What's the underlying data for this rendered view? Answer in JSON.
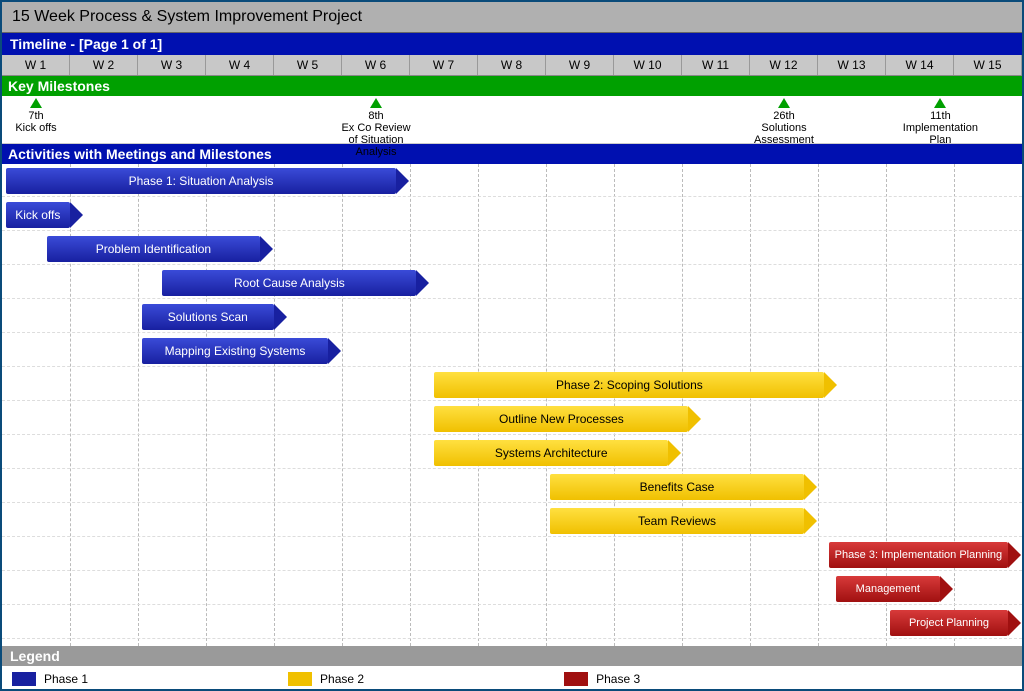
{
  "title": "15 Week Process & System Improvement Project",
  "timeline_label": "Timeline - [Page 1 of 1]",
  "weeks": [
    "W 1",
    "W 2",
    "W 3",
    "W 4",
    "W 5",
    "W 6",
    "W 7",
    "W 8",
    "W 9",
    "W 10",
    "W 11",
    "W 12",
    "W 13",
    "W 14",
    "W 15"
  ],
  "milestones_header": "Key Milestones",
  "activities_header": "Activities with Meetings and Milestones",
  "legend_header": "Legend",
  "milestones": [
    {
      "date": "7th",
      "label": "Kick offs",
      "week": 1
    },
    {
      "date": "8th",
      "label": "Ex Co Review of Situation Analysis",
      "week": 6
    },
    {
      "date": "26th",
      "label": "Solutions Assessment",
      "week": 12
    },
    {
      "date": "11th",
      "label": "Implementation Plan",
      "week": 14.3
    }
  ],
  "legend": [
    {
      "label": "Phase 1",
      "class": "p1"
    },
    {
      "label": "Phase 2",
      "class": "p2"
    },
    {
      "label": "Phase 3",
      "class": "p3"
    }
  ],
  "chart_data": {
    "type": "gantt",
    "title": "15 Week Process & System Improvement Project",
    "xlabel": "Week",
    "x_range": [
      0,
      15
    ],
    "series": [
      {
        "name": "Phase 1: Situation Analysis",
        "phase": "phase1",
        "start": 0,
        "end": 6,
        "row": 0
      },
      {
        "name": "Kick offs",
        "phase": "phase1",
        "start": 0,
        "end": 1.2,
        "row": 1
      },
      {
        "name": "Problem Identification",
        "phase": "phase1",
        "start": 0.6,
        "end": 4,
        "row": 2
      },
      {
        "name": "Root Cause Analysis",
        "phase": "phase1",
        "start": 2.3,
        "end": 6.3,
        "row": 3
      },
      {
        "name": "Solutions Scan",
        "phase": "phase1",
        "start": 2,
        "end": 4.2,
        "row": 4
      },
      {
        "name": "Mapping Existing Systems",
        "phase": "phase1",
        "start": 2,
        "end": 5,
        "row": 5
      },
      {
        "name": "Phase 2: Scoping Solutions",
        "phase": "phase2",
        "start": 6.3,
        "end": 12.3,
        "row": 6
      },
      {
        "name": "Outline New Processes",
        "phase": "phase2",
        "start": 6.3,
        "end": 10.3,
        "row": 7
      },
      {
        "name": "Systems Architecture",
        "phase": "phase2",
        "start": 6.3,
        "end": 10,
        "row": 8
      },
      {
        "name": "Benefits Case",
        "phase": "phase2",
        "start": 8,
        "end": 12,
        "row": 9
      },
      {
        "name": "Team Reviews",
        "phase": "phase2",
        "start": 8,
        "end": 12,
        "row": 10
      },
      {
        "name": "Phase 3: Implementation Planning",
        "phase": "phase3",
        "start": 12.1,
        "end": 15,
        "row": 11
      },
      {
        "name": "Management Briefings",
        "phase": "phase3",
        "start": 12.2,
        "end": 14,
        "row": 12
      },
      {
        "name": "Project Planning",
        "phase": "phase3",
        "start": 13,
        "end": 15,
        "row": 13
      }
    ]
  }
}
